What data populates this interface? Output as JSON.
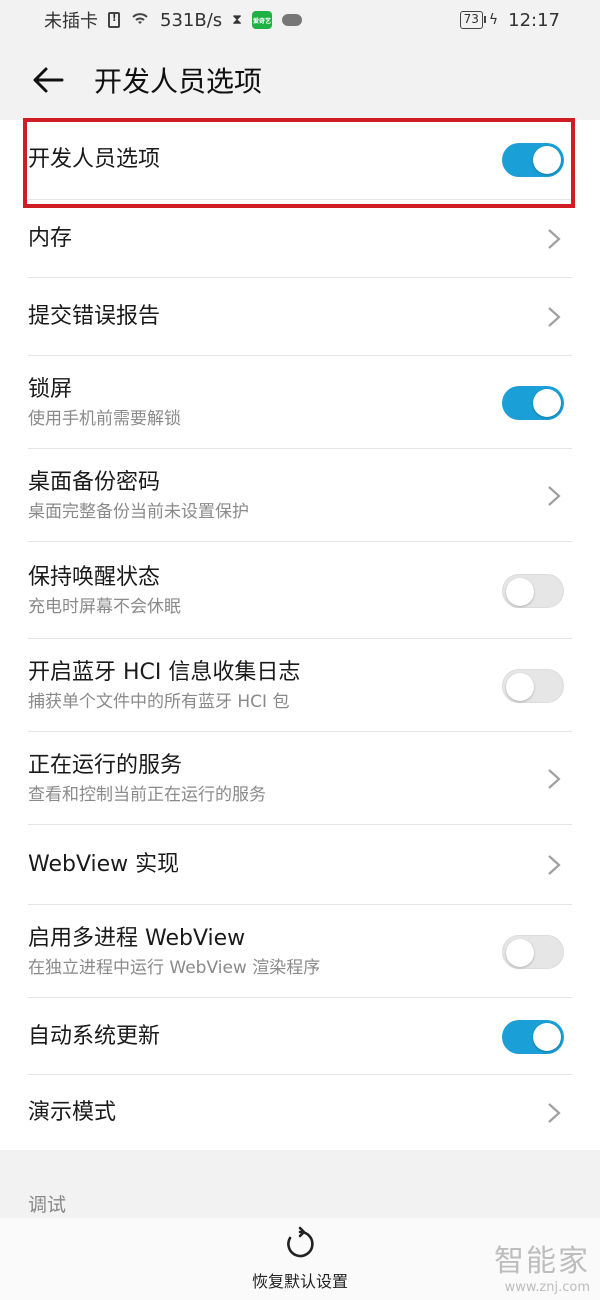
{
  "status_bar": {
    "carrier": "未插卡",
    "speed": "531B/s",
    "battery": "73",
    "time": "12:17",
    "app_badge": "爱奇艺"
  },
  "header": {
    "title": "开发人员选项",
    "back_icon": "back-arrow-icon"
  },
  "settings": [
    {
      "title": "开发人员选项",
      "subtitle": "",
      "control": "toggle",
      "state": "on"
    },
    {
      "title": "内存",
      "subtitle": "",
      "control": "chevron"
    },
    {
      "title": "提交错误报告",
      "subtitle": "",
      "control": "chevron"
    },
    {
      "title": "锁屏",
      "subtitle": "使用手机前需要解锁",
      "control": "toggle",
      "state": "on"
    },
    {
      "title": "桌面备份密码",
      "subtitle": "桌面完整备份当前未设置保护",
      "control": "chevron"
    },
    {
      "title": "保持唤醒状态",
      "subtitle": "充电时屏幕不会休眠",
      "control": "toggle",
      "state": "off"
    },
    {
      "title": "开启蓝牙 HCI 信息收集日志",
      "subtitle": "捕获单个文件中的所有蓝牙 HCI 包",
      "control": "toggle",
      "state": "off"
    },
    {
      "title": "正在运行的服务",
      "subtitle": "查看和控制当前正在运行的服务",
      "control": "chevron"
    },
    {
      "title": "WebView 实现",
      "subtitle": "",
      "control": "chevron"
    },
    {
      "title": "启用多进程 WebView",
      "subtitle": "在独立进程中运行 WebView 渲染程序",
      "control": "toggle",
      "state": "off"
    },
    {
      "title": "自动系统更新",
      "subtitle": "",
      "control": "toggle",
      "state": "on"
    },
    {
      "title": "演示模式",
      "subtitle": "",
      "control": "chevron"
    }
  ],
  "section": {
    "label": "调试"
  },
  "bottom": {
    "restore_label": "恢复默认设置"
  },
  "watermark": {
    "main": "智能家",
    "sub": "www.znj.com"
  },
  "colors": {
    "accent": "#1a9fd6",
    "highlight": "#d01c23"
  }
}
